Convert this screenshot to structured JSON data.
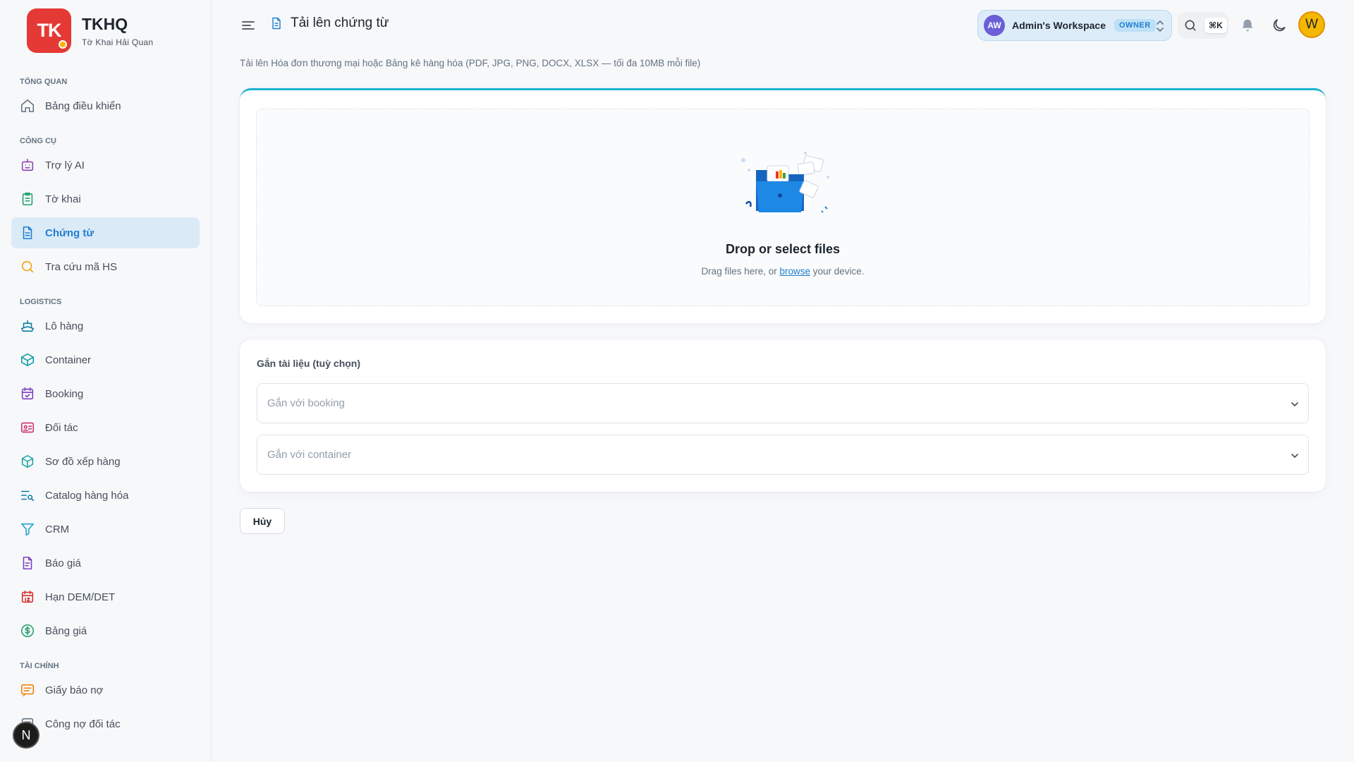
{
  "brand": {
    "logo_text": "TK",
    "title": "TKHQ",
    "subtitle": "Tờ Khai Hải Quan"
  },
  "sidebar": {
    "sections": [
      {
        "label": "Tổng quan",
        "items": [
          {
            "label": "Bảng điều khiển",
            "icon": "home-icon"
          }
        ]
      },
      {
        "label": "Công cụ",
        "items": [
          {
            "label": "Trợ lý AI",
            "icon": "robot-icon"
          },
          {
            "label": "Tờ khai",
            "icon": "clipboard-icon"
          },
          {
            "label": "Chứng từ",
            "icon": "document-icon",
            "active": true
          },
          {
            "label": "Tra cứu mã HS",
            "icon": "search-icon"
          }
        ]
      },
      {
        "label": "Logistics",
        "items": [
          {
            "label": "Lô hàng",
            "icon": "ship-icon"
          },
          {
            "label": "Container",
            "icon": "box-icon"
          },
          {
            "label": "Booking",
            "icon": "calendar-check-icon"
          },
          {
            "label": "Đối tác",
            "icon": "id-card-icon"
          },
          {
            "label": "Sơ đồ xếp hàng",
            "icon": "cube-icon"
          },
          {
            "label": "Catalog hàng hóa",
            "icon": "list-search-icon"
          },
          {
            "label": "CRM",
            "icon": "funnel-icon"
          },
          {
            "label": "Báo giá",
            "icon": "quote-doc-icon"
          },
          {
            "label": "Hạn DEM/DET",
            "icon": "calendar-12-icon"
          },
          {
            "label": "Bảng giá",
            "icon": "dollar-circle-icon"
          }
        ]
      },
      {
        "label": "Tài chính",
        "items": [
          {
            "label": "Giấy báo nợ",
            "icon": "message-lines-icon"
          },
          {
            "label": "Công nợ đối tác",
            "icon": "ledger-icon"
          }
        ]
      }
    ]
  },
  "header": {
    "page_title": "Tải lên chứng từ",
    "workspace": {
      "initials": "AW",
      "name": "Admin's Workspace",
      "role": "OWNER"
    },
    "search_shortcut": "⌘K",
    "user_initial": "W"
  },
  "main": {
    "subtitle": "Tải lên Hóa đơn thương mại hoặc Bảng kê hàng hóa (PDF, JPG, PNG, DOCX, XLSX — tối đa 10MB mỗi file)",
    "dropzone": {
      "title": "Drop or select files",
      "sub_before": "Drag files here, or ",
      "browse_link": "browse",
      "sub_after": " your device."
    },
    "attach": {
      "label": "Gắn tài liệu (tuỳ chọn)",
      "booking_placeholder": "Gắn với booking",
      "container_placeholder": "Gắn với container"
    },
    "cancel_label": "Hủy"
  },
  "floating_badge": "N",
  "colors": {
    "brand_red": "#e53935",
    "accent_blue": "#1e7fd0",
    "active_bg": "#dbeaf7",
    "card_top": "#1bb3d1"
  }
}
